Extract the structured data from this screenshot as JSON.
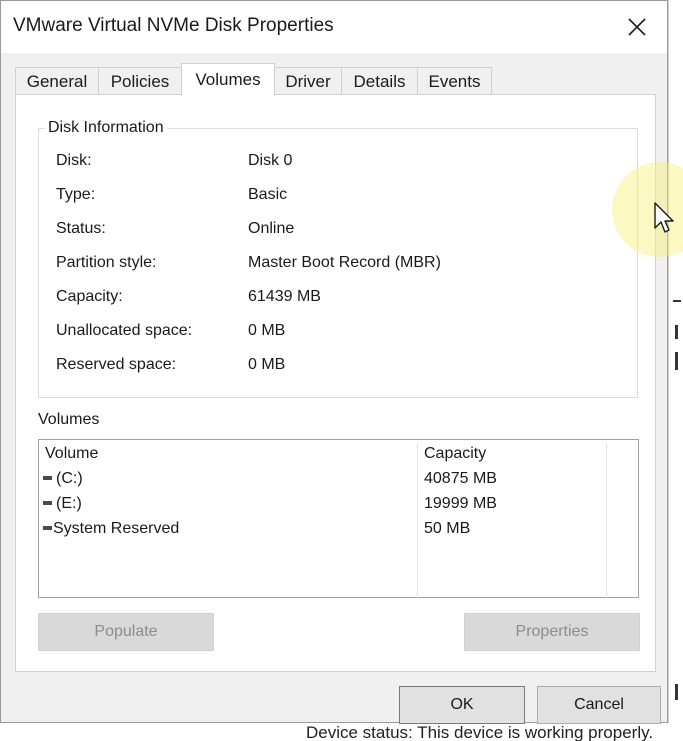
{
  "window": {
    "title": "VMware Virtual NVMe Disk Properties",
    "close_icon": "close-icon"
  },
  "tabs": [
    {
      "label": "General",
      "active": false
    },
    {
      "label": "Policies",
      "active": false
    },
    {
      "label": "Volumes",
      "active": true
    },
    {
      "label": "Driver",
      "active": false
    },
    {
      "label": "Details",
      "active": false
    },
    {
      "label": "Events",
      "active": false
    }
  ],
  "disk_info": {
    "group_title": "Disk Information",
    "rows": [
      {
        "label": "Disk:",
        "value": "Disk 0"
      },
      {
        "label": "Type:",
        "value": "Basic"
      },
      {
        "label": "Status:",
        "value": "Online"
      },
      {
        "label": "Partition style:",
        "value": "Master Boot Record (MBR)"
      },
      {
        "label": "Capacity:",
        "value": "61439 MB"
      },
      {
        "label": "Unallocated space:",
        "value": "0 MB"
      },
      {
        "label": "Reserved space:",
        "value": "0 MB"
      }
    ]
  },
  "volumes": {
    "label": "Volumes",
    "columns": [
      "Volume",
      "Capacity"
    ],
    "rows": [
      {
        "volume": "(C:)",
        "capacity": "40875 MB",
        "icon": "drive-icon"
      },
      {
        "volume": "(E:)",
        "capacity": "19999 MB",
        "icon": "drive-icon"
      },
      {
        "volume": "System Reserved",
        "capacity": "50 MB",
        "icon": "drive-icon"
      }
    ]
  },
  "buttons": {
    "populate": "Populate",
    "properties": "Properties",
    "ok": "OK",
    "cancel": "Cancel"
  },
  "background": {
    "bottom_text": "Device status:    This device is working properly."
  },
  "colors": {
    "dialog_bg": "#f0f0f0",
    "panel_bg": "#ffffff",
    "disabled_text": "#8c8c8c",
    "cursor_highlight": "#f6f078"
  }
}
